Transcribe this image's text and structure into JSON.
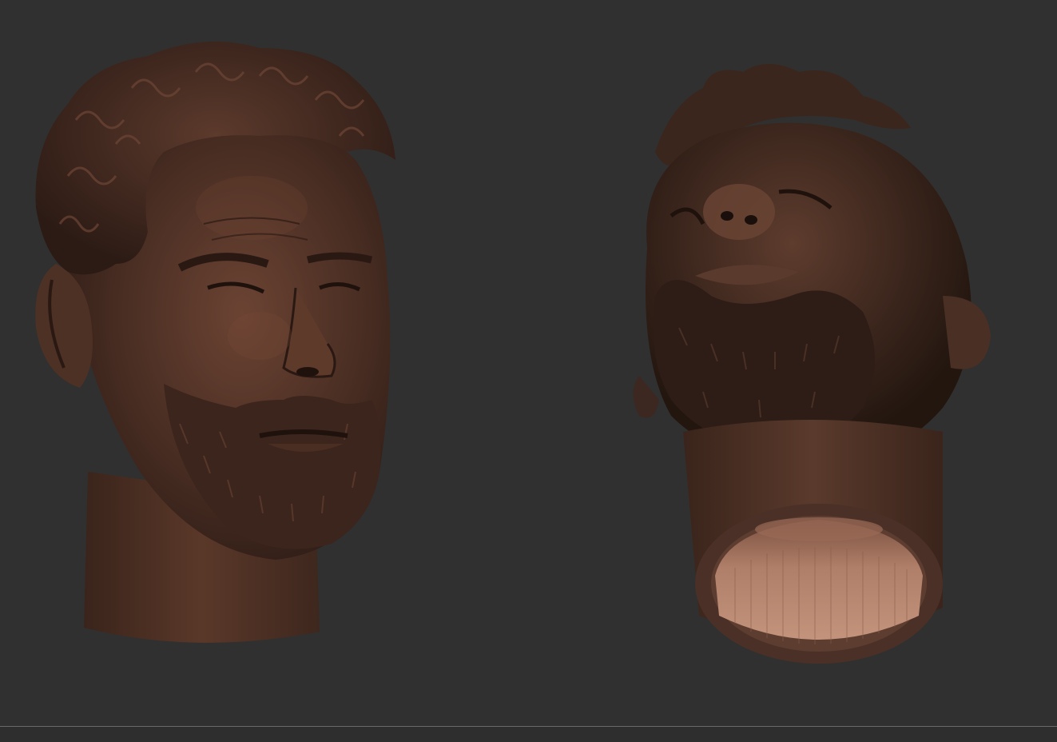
{
  "viewport": {
    "background": "#303030",
    "material_color": "#5a3a2c",
    "highlight_color": "#8a5a44",
    "interior_color": "#a77864"
  },
  "models": [
    {
      "name": "head-front-three-quarter",
      "icon": "sculpt-head-front"
    },
    {
      "name": "head-bottom-view",
      "icon": "sculpt-head-bottom"
    }
  ]
}
